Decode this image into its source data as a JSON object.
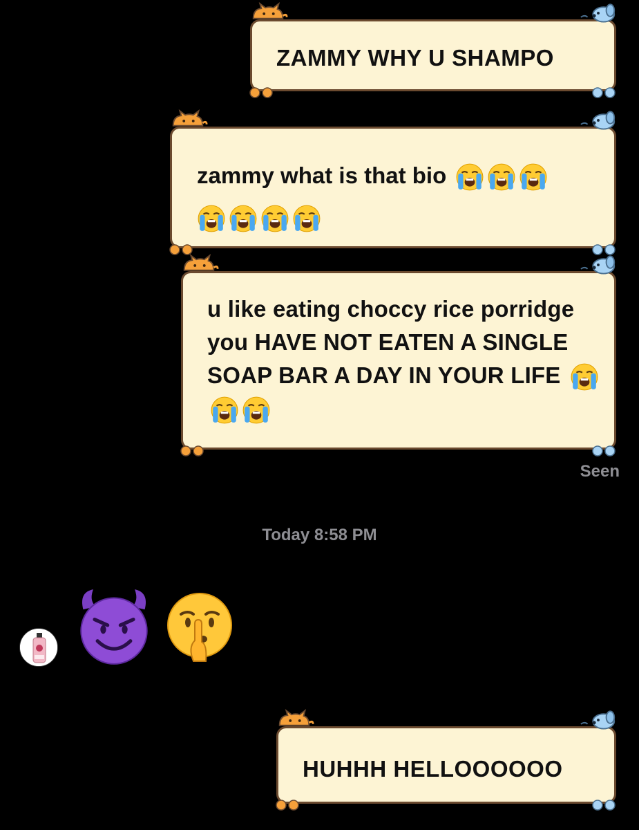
{
  "messages": [
    {
      "text": "ZAMMY WHY U SHAMPO",
      "emoji_count": 0
    },
    {
      "text": "zammy what is that bio",
      "emoji_count": 7
    },
    {
      "text": "u like eating choccy rice porridge you HAVE NOT EATEN A SINGLE SOAP BAR A DAY IN YOUR LIFE",
      "emoji_count": 3
    },
    {
      "text": "HUHHH HELLOOOOOO",
      "emoji_count": 0
    }
  ],
  "status": {
    "seen": "Seen"
  },
  "timestamp": "Today 8:58 PM",
  "received": {
    "emojis": [
      "smiling-devil-icon",
      "shushing-face-icon"
    ]
  },
  "icons": {
    "inline_emoji": "loudly-crying-face-icon",
    "decor_top_left": "cat-icon",
    "decor_top_right": "dog-icon",
    "decor_bottom": "paw-icon",
    "avatar": "shampoo-bottle-avatar"
  },
  "colors": {
    "background": "#000000",
    "bubble_fill": "#fdf4d4",
    "bubble_border": "#6b4a2f",
    "meta_text": "#8e8e93"
  }
}
